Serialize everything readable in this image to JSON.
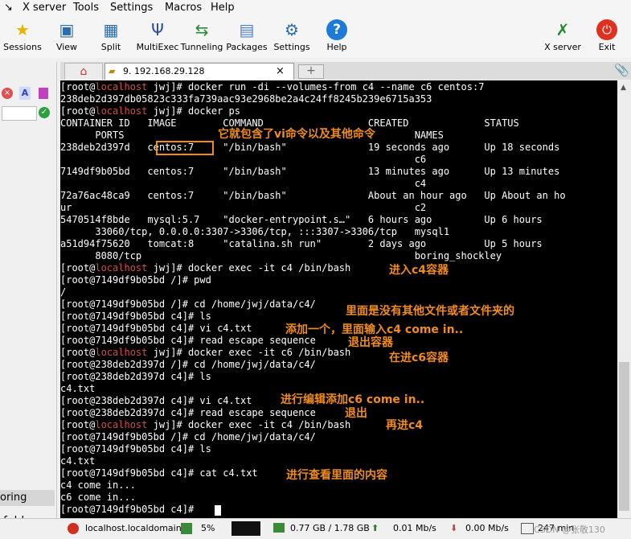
{
  "menubar": {
    "items": [
      "X server",
      "Tools",
      "Settings",
      "Macros",
      "Help"
    ]
  },
  "toolbar": {
    "buttons": [
      "Sessions",
      "View",
      "Split",
      "MultiExec",
      "Tunneling",
      "Packages",
      "Settings",
      "Help"
    ],
    "xserver": "X server",
    "exit": "Exit"
  },
  "tabs": {
    "active": "9. 192.168.29.128",
    "new": "+"
  },
  "sidebar": {
    "items": [
      "oring",
      "folder"
    ]
  },
  "terminal": {
    "host": "localhost",
    "lines": [
      {
        "p": "[root@",
        "h": "localhost",
        "t": " jwj]# docker run -di --volumes-from c4 --name c6 centos:7"
      },
      {
        "t": "238deb2d397db05823c333fa739aac93e2968be2a4c24ff8245b239e6715a353"
      },
      {
        "p": "[root@",
        "h": "localhost",
        "t": " jwj]# docker ps"
      },
      {
        "t": "CONTAINER ID   IMAGE        COMMAND                  CREATED             STATUS"
      },
      {
        "t": "      PORTS                                                  NAMES"
      },
      {
        "t": "238deb2d397d   centos:7     \"/bin/bash\"              19 seconds ago      Up 18 seconds"
      },
      {
        "t": "                                                             c6"
      },
      {
        "t": "7149df9b05bd   centos:7     \"/bin/bash\"              13 minutes ago      Up 13 minutes"
      },
      {
        "t": "                                                             c4"
      },
      {
        "t": "72a76ac48ca9   centos:7     \"/bin/bash\"              About an hour ago   Up About an ho"
      },
      {
        "t": "ur                                                           c2"
      },
      {
        "t": "5470514f8bde   mysql:5.7    \"docker-entrypoint.s…\"   6 hours ago         Up 6 hours"
      },
      {
        "t": "      33060/tcp, 0.0.0.0:3307->3306/tcp, :::3307->3306/tcp   mysql1"
      },
      {
        "t": "a51d94f75620   tomcat:8     \"catalina.sh run\"        2 days ago          Up 5 hours"
      },
      {
        "t": "      8080/tcp                                               boring_shockley"
      },
      {
        "p": "[root@",
        "h": "localhost",
        "t": " jwj]# docker exec -it c4 /bin/bash"
      },
      {
        "t": "[root@7149df9b05bd /]# pwd"
      },
      {
        "t": "/"
      },
      {
        "t": "[root@7149df9b05bd /]# cd /home/jwj/data/c4/"
      },
      {
        "t": "[root@7149df9b05bd c4]# ls"
      },
      {
        "t": "[root@7149df9b05bd c4]# vi c4.txt"
      },
      {
        "t": "[root@7149df9b05bd c4]# read escape sequence"
      },
      {
        "p": "[root@",
        "h": "localhost",
        "t": " jwj]# docker exec -it c6 /bin/bash"
      },
      {
        "t": "[root@238deb2d397d /]# cd /home/jwj/data/c4/"
      },
      {
        "t": "[root@238deb2d397d c4]# ls"
      },
      {
        "t": "c4.txt"
      },
      {
        "t": "[root@238deb2d397d c4]# vi c4.txt"
      },
      {
        "t": "[root@238deb2d397d c4]# read escape sequence"
      },
      {
        "p": "[root@",
        "h": "localhost",
        "t": " jwj]# docker exec -it c4 /bin/bash"
      },
      {
        "t": "[root@7149df9b05bd /]# cd /home/jwj/data/c4/"
      },
      {
        "t": "[root@7149df9b05bd c4]# ls"
      },
      {
        "t": "c4.txt"
      },
      {
        "t": "[root@7149df9b05bd c4]# cat c4.txt"
      },
      {
        "t": "c4 come in..."
      },
      {
        "t": "c6 come in..."
      },
      {
        "t": "[root@7149df9b05bd c4]# "
      }
    ]
  },
  "annotations": [
    "它就包含了vi命令以及其他命令",
    "进入c4容器",
    "里面是没有其他文件或者文件夹的",
    "添加一个，里面输入c4 come in..",
    "退出容器",
    "在进c6容器",
    "进行编辑添加c6 come in..",
    "退出",
    "再进c4",
    "进行查看里面的内容"
  ],
  "statusbar": {
    "host": "localhost.localdomain",
    "cpu": "5%",
    "mem": "0.77 GB / 1.78 GB",
    "up": "0.01 Mb/s",
    "down": "0.00 Mb/s",
    "time": "247 min",
    "watermark": "CSDN @张敬130"
  },
  "colors": {
    "prompt_host": "#d84a4a",
    "annotation": "#f08c1a",
    "terminal_bg": "#000000"
  }
}
